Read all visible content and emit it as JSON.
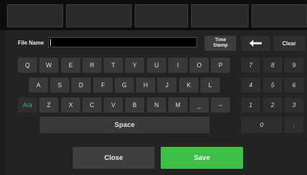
{
  "file_name": {
    "label": "File Name",
    "value": ""
  },
  "buttons": {
    "time_stamp_line1": "Time",
    "time_stamp_line2": "Stamp",
    "backspace_icon": "left-arrow-icon",
    "clear": "Clear",
    "close": "Close",
    "save": "Save"
  },
  "keyboard": {
    "row1": [
      "Q",
      "W",
      "E",
      "R",
      "T",
      "Y",
      "U",
      "I",
      "O",
      "P"
    ],
    "row2": [
      "A",
      "S",
      "D",
      "F",
      "G",
      "H",
      "J",
      "K",
      "L"
    ],
    "case_toggle": "A/a",
    "row3": [
      "Z",
      "X",
      "C",
      "V",
      "B",
      "N",
      "M",
      "_",
      "–"
    ],
    "space": "Space"
  },
  "numpad": {
    "row1": [
      "7",
      "8",
      "9"
    ],
    "row2": [
      "4",
      "5",
      "6"
    ],
    "row3": [
      "1",
      "2",
      "3"
    ],
    "zero": "0",
    "dot": "."
  },
  "colors": {
    "save_green": "#3ec047",
    "case_toggle_green": "#35c13a",
    "background": "#1c1c1c"
  }
}
